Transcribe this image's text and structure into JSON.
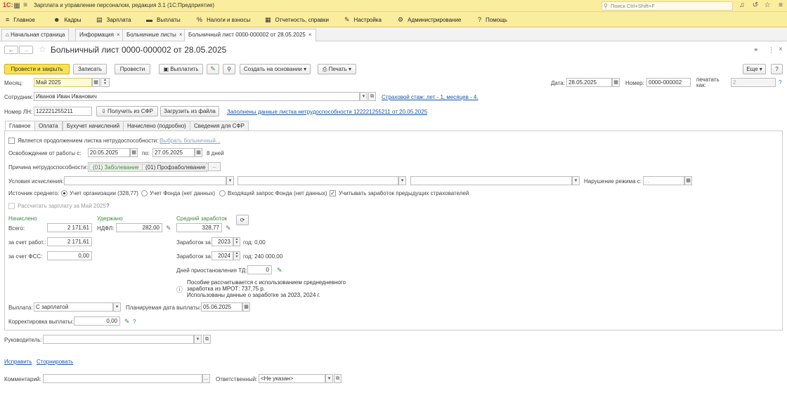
{
  "app": {
    "logo": "1С:",
    "title": "Зарплата и управление персоналом, редакция 3.1  (1С:Предприятие)",
    "search_placeholder": "Поиск Ctrl+Shift+F"
  },
  "menu": [
    {
      "label": "Главное",
      "icon": "≡"
    },
    {
      "label": "Кадры",
      "icon": "👥"
    },
    {
      "label": "Зарплата",
      "icon": "▤"
    },
    {
      "label": "Выплаты",
      "icon": "▬"
    },
    {
      "label": "Налоги и взносы",
      "icon": "%"
    },
    {
      "label": "Отчетность, справки",
      "icon": "▦"
    },
    {
      "label": "Настройка",
      "icon": "🔧"
    },
    {
      "label": "Администрирование",
      "icon": "⚙"
    },
    {
      "label": "Помощь",
      "icon": "?"
    }
  ],
  "tabs": [
    {
      "label": "Начальная страница"
    },
    {
      "label": "Информация"
    },
    {
      "label": "Больничные листы"
    },
    {
      "label": "Больничный лист 0000-000002 от 28.05.2025"
    }
  ],
  "doc": {
    "title": "Больничный лист 0000-000002 от 28.05.2025"
  },
  "toolbar": {
    "post_close": "Провести и закрыть",
    "save": "Записать",
    "post": "Провести",
    "pay": "Выплатить",
    "create_based": "Создать на основании",
    "print": "Печать",
    "more": "Еще",
    "help": "?"
  },
  "header": {
    "month_label": "Месяц:",
    "month_value": "Май 2025",
    "date_label": "Дата:",
    "date_value": "28.05.2025",
    "number_label": "Номер:",
    "number_value": "0000-000002",
    "print_as_label_1": "печатать",
    "print_as_label_2": "как:",
    "print_as_value": "2",
    "employee_label": "Сотрудник:",
    "employee_value": "Иванов Иван Иванович",
    "insurance_link": "Страховой стаж: лет - 1, месяцев - 4.",
    "ln_label": "Номер ЛН:",
    "ln_value": "122221255211",
    "get_sfr": "Получить из СФР",
    "load_file": "Загрузить из файла",
    "filled_link": "Заполнены данные листка нетрудоспособности 122221255211 от 20.05.2025"
  },
  "form_tabs": [
    {
      "label": "Главное"
    },
    {
      "label": "Оплата"
    },
    {
      "label": "Бухучет начислений"
    },
    {
      "label": "Начислено (подробно)"
    },
    {
      "label": "Сведения для СФР"
    }
  ],
  "main": {
    "continuation_label": "Является продолжением листка нетрудоспособности:",
    "choose_sick_link": "Выбрать больничный...",
    "release_label": "Освобождение от работы с:",
    "release_from": "20.05.2025",
    "release_to_label": "по:",
    "release_to": "27.05.2025",
    "days": "8 дней",
    "reason_label": "Причина нетрудоспособности:",
    "reason_1": "(01) Заболевание",
    "reason_2": "(01) Профзаболевание",
    "reason_more": "...",
    "conditions_label": "Условия исчисления:",
    "violation_label": "Нарушение режима с:",
    "violation_value": " .  .",
    "avg_source_label": "Источник среднего:",
    "avg_opt_1": "Учет организации (328,77)",
    "avg_opt_2": "Учет Фонда (нет данных)",
    "avg_opt_3": "Входящий запрос Фонда (нет данных)",
    "consider_prev": "Учитывать заработок предыдущих страхователей",
    "calc_salary": "Рассчитать зарплату за Май 2025",
    "calc_q": "?",
    "accrued_title": "Начислено",
    "withheld_title": "Удержано",
    "avg_title": "Средний заработок",
    "total_label": "Всего:",
    "total_value": "2 171,61",
    "ndfl_label": "НДФЛ:",
    "ndfl_value": "282,00",
    "avg_value": "328,77",
    "employer_label": "за счет работ.:",
    "employer_value": "2 171,61",
    "fss_label": "за счет ФСС:",
    "fss_value": "0,00",
    "earn_label": "Заработок за",
    "year1": "2023",
    "year_word": "год:",
    "earn1": "0,00",
    "year2": "2024",
    "earn2": "240 000,00",
    "suspension_label": "Дней приостановления ТД:",
    "suspension_value": "0",
    "info_1": "Пособие рассчитывается с использованием среднедневного",
    "info_2": "заработка из МРОТ: 737,75 р.",
    "info_3": "Использованы данные о заработке за  2023,  2024 г.",
    "payment_label": "Выплата:",
    "payment_value": "С зарплатой",
    "planned_label": "Планируемая дата выплаты:",
    "planned_value": "05.06.2025",
    "correction_label": "Корректировка выплаты:",
    "correction_value": "0,00",
    "correction_q": "?"
  },
  "footer": {
    "manager_label": "Руководитель:",
    "fix_link": "Исправить",
    "storno_link": "Сторнировать",
    "comment_label": "Комментарий:",
    "responsible_label": "Ответственный:",
    "responsible_value": "<Не указан>"
  }
}
